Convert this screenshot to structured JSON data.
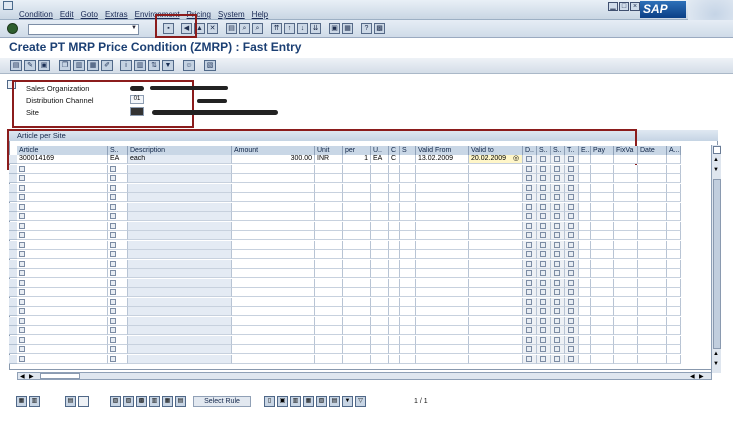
{
  "menu": [
    "Condition",
    "Edit",
    "Goto",
    "Extras",
    "Environment",
    "Pricing",
    "System",
    "Help"
  ],
  "window_controls": [
    "minimize",
    "maximize",
    "close"
  ],
  "logo_text": "SAP",
  "title": "Create PT MRP Price Condition (ZMRP) : Fast Entry",
  "header": {
    "sales_org_label": "Sales Organization",
    "dist_channel_label": "Distribution Channel",
    "dist_channel_value": "01",
    "site_label": "Site"
  },
  "table": {
    "title": "Article per Site",
    "columns": [
      "Article",
      "S..",
      "Description",
      "Amount",
      "Unit",
      "per",
      "U..",
      "C",
      "S",
      "Valid From",
      "Valid to",
      "D..",
      "S..",
      "S..",
      "T..",
      "E..",
      "Pay",
      "FixVa",
      "Date",
      "A..."
    ],
    "row": {
      "article": "300014169",
      "s": "EA",
      "description": "each",
      "amount": "300.00",
      "unit": "INR",
      "per": "1",
      "uom": "EA",
      "c": "C",
      "valid_from": "13.02.2009",
      "valid_to": "20.02.2009"
    }
  },
  "bottom": {
    "select_rule_label": "Select Rule",
    "page_indicator": "1 / 1"
  }
}
